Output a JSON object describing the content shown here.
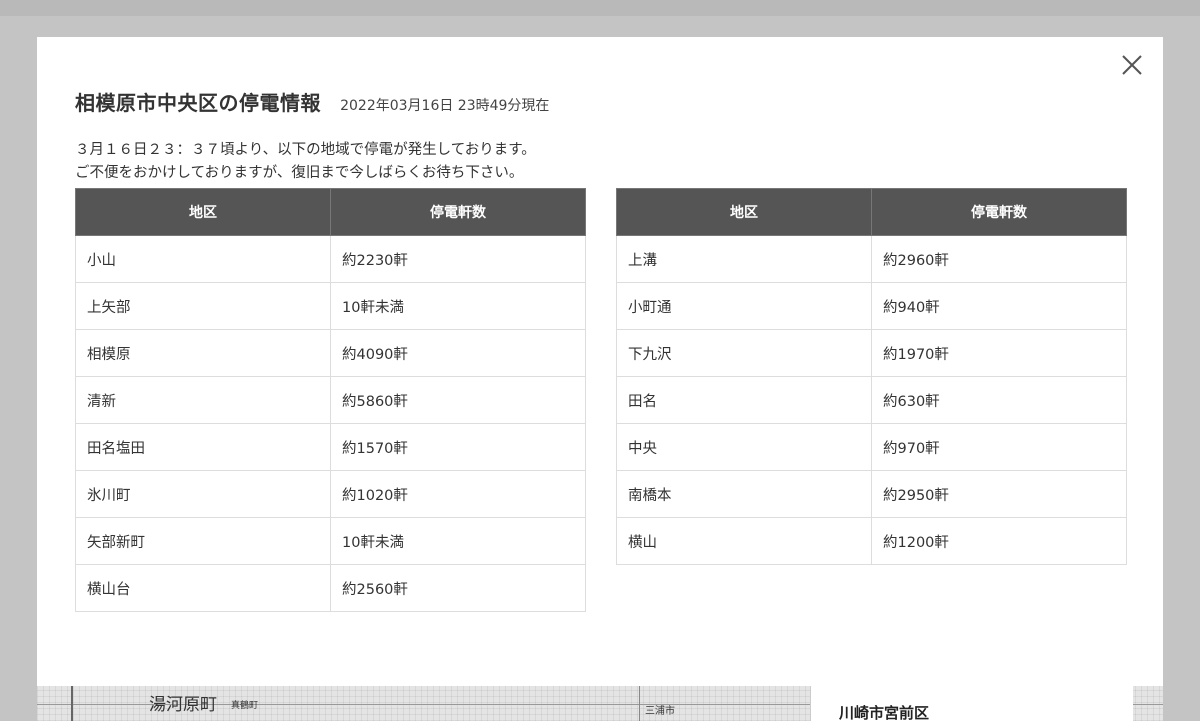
{
  "modal": {
    "title": "相模原市中央区の停電情報",
    "timestamp": "2022年03月16日 23時49分現在",
    "message_lines": [
      "３月１６日２３：３７頃より、以下の地域で停電が発生しております。",
      "ご不便をおかけしておりますが、復旧まで今しばらくお待ち下さい。"
    ],
    "close_icon": "close-icon"
  },
  "table_headers": {
    "area": "地区",
    "count": "停電軒数"
  },
  "left_rows": [
    {
      "area": "小山",
      "count": "約2230軒"
    },
    {
      "area": "上矢部",
      "count": "10軒未満"
    },
    {
      "area": "相模原",
      "count": "約4090軒"
    },
    {
      "area": "清新",
      "count": "約5860軒"
    },
    {
      "area": "田名塩田",
      "count": "約1570軒"
    },
    {
      "area": "氷川町",
      "count": "約1020軒"
    },
    {
      "area": "矢部新町",
      "count": "10軒未満"
    },
    {
      "area": "横山台",
      "count": "約2560軒"
    }
  ],
  "right_rows": [
    {
      "area": "上溝",
      "count": "約2960軒"
    },
    {
      "area": "小町通",
      "count": "約940軒"
    },
    {
      "area": "下九沢",
      "count": "約1970軒"
    },
    {
      "area": "田名",
      "count": "約630軒"
    },
    {
      "area": "中央",
      "count": "約970軒"
    },
    {
      "area": "南橋本",
      "count": "約2950軒"
    },
    {
      "area": "横山",
      "count": "約1200軒"
    }
  ],
  "map": {
    "label_big": "湯河原町",
    "label_small1": "真鶴町",
    "label_small2": "三浦市",
    "side_title": "川崎市宮前区"
  },
  "colors": {
    "header_bg": "#555555",
    "overlay": "#c4c4c4"
  }
}
